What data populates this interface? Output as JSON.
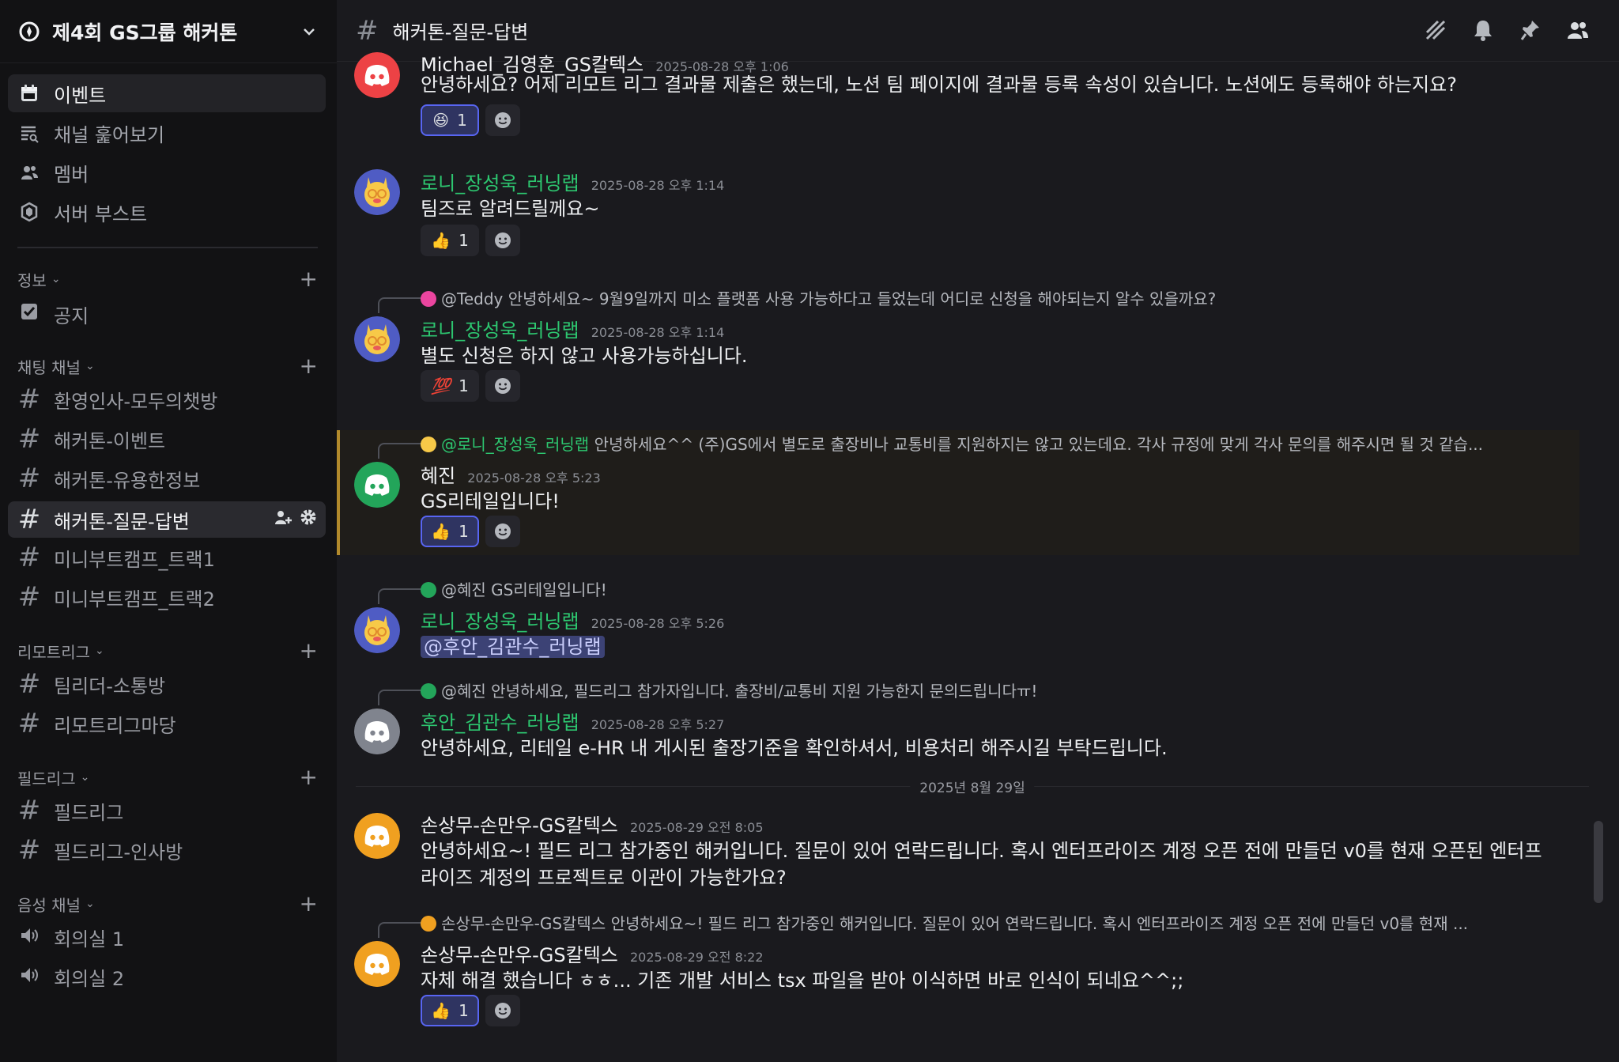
{
  "server": {
    "name": "제4회 GS그룹 해커톤"
  },
  "top_nav": [
    {
      "label": "이벤트",
      "icon": "calendar-icon",
      "active": true
    },
    {
      "label": "채널 훑어보기",
      "icon": "browse-channels-icon",
      "active": false
    },
    {
      "label": "멤버",
      "icon": "members-icon",
      "active": false
    },
    {
      "label": "서버 부스트",
      "icon": "boost-icon",
      "active": false
    }
  ],
  "categories": {
    "info": {
      "label": "정보",
      "channels": [
        "공지"
      ]
    },
    "chat": {
      "label": "채팅 채널",
      "channels": [
        "환영인사-모두의챗방",
        "해커톤-이벤트",
        "해커톤-유용한정보",
        "해커톤-질문-답변",
        "미니부트캠프_트랙1",
        "미니부트캠프_트랙2"
      ]
    },
    "remote": {
      "label": "리모트리그",
      "channels": [
        "팀리더-소통방",
        "리모트리그마당"
      ]
    },
    "field": {
      "label": "필드리그",
      "channels": [
        "필드리그",
        "필드리그-인사방"
      ]
    },
    "voice": {
      "label": "음성 채널",
      "channels": [
        "회의실 1",
        "회의실 2"
      ]
    }
  },
  "channel": {
    "title": "해커톤-질문-답변"
  },
  "messages": {
    "m1": {
      "user": "Michael_김영훈_GS칼텍스",
      "time": "2025-08-28 오후 1:06",
      "text": "안녕하세요? 어제 리모트 리그 결과물 제출은 했는데, 노션 팀 페이지에 결과물 등록 속성이 있습니다. 노션에도 등록해야 하는지요?",
      "reaction": {
        "emoji": "😆",
        "count": "1"
      }
    },
    "m2": {
      "user": "로니_장성욱_러닝랩",
      "time": "2025-08-28 오후 1:14",
      "text": "팀즈로 알려드릴께요~",
      "reaction": {
        "emoji": "👍",
        "count": "1"
      }
    },
    "m3": {
      "reply_user": "@Teddy",
      "reply_text": "안녕하세요~ 9월9일까지 미소 플랫폼 사용 가능하다고 들었는데  어디로 신청을 해야되는지 알수 있을까요?",
      "user": "로니_장성욱_러닝랩",
      "time": "2025-08-28 오후 1:14",
      "text": "별도 신청은 하지 않고 사용가능하십니다.",
      "reaction": {
        "emoji": "💯",
        "count": "1"
      }
    },
    "m4": {
      "reply_user": "@로니_장성욱_러닝랩",
      "reply_text": "안녕하세요^^ (주)GS에서 별도로 출장비나 교통비를 지원하지는 않고 있는데요. 각사 규정에 맞게 각사 문의를 해주시면 될 것 같습...",
      "user": "혜진",
      "time": "2025-08-28 오후 5:23",
      "text": "GS리테일입니다!",
      "reaction": {
        "emoji": "👍",
        "count": "1"
      }
    },
    "m5": {
      "reply_user": "@혜진",
      "reply_text": "GS리테일입니다!",
      "user": "로니_장성욱_러닝랩",
      "time": "2025-08-28 오후 5:26",
      "mention": "@후안_김관수_러닝랩"
    },
    "m6": {
      "reply_user": "@혜진",
      "reply_text": "안녕하세요, 필드리그 참가자입니다. 출장비/교통비 지원 가능한지 문의드립니다ㅠ!",
      "user": "후안_김관수_러닝랩",
      "time": "2025-08-28 오후 5:27",
      "text": "안녕하세요, 리테일 e-HR 내 게시된 출장기준을 확인하셔서, 비용처리 해주시길 부탁드립니다."
    },
    "date_separator": "2025년 8월 29일",
    "m7": {
      "user": "손상무-손만우-GS칼텍스",
      "time": "2025-08-29 오전 8:05",
      "text": "안녕하세요~! 필드 리그 참가중인 해커입니다. 질문이 있어 연락드립니다. 혹시 엔터프라이즈 계정 오픈 전에 만들던 v0를 현재 오픈된 엔터프라이즈 계정의 프로젝트로 이관이 가능한가요?"
    },
    "m8": {
      "reply_user": "손상무-손만우-GS칼텍스",
      "reply_text": "안녕하세요~! 필드 리그 참가중인 해커입니다. 질문이 있어 연락드립니다. 혹시 엔터프라이즈 계정 오픈 전에 만들던 v0를 현재 ...",
      "user": "손상무-손만우-GS칼텍스",
      "time": "2025-08-29 오전 8:22",
      "text": "자체 해결 했습니다 ㅎㅎ... 기존 개발 서비스 tsx 파일을 받아 이식하면 바로 인식이 되네요^^;;",
      "reaction": {
        "emoji": "👍",
        "count": "1"
      }
    }
  },
  "colors": {
    "accent": "#5865f2",
    "green_name": "#2dc770",
    "highlight_bar": "#b28a2c"
  }
}
